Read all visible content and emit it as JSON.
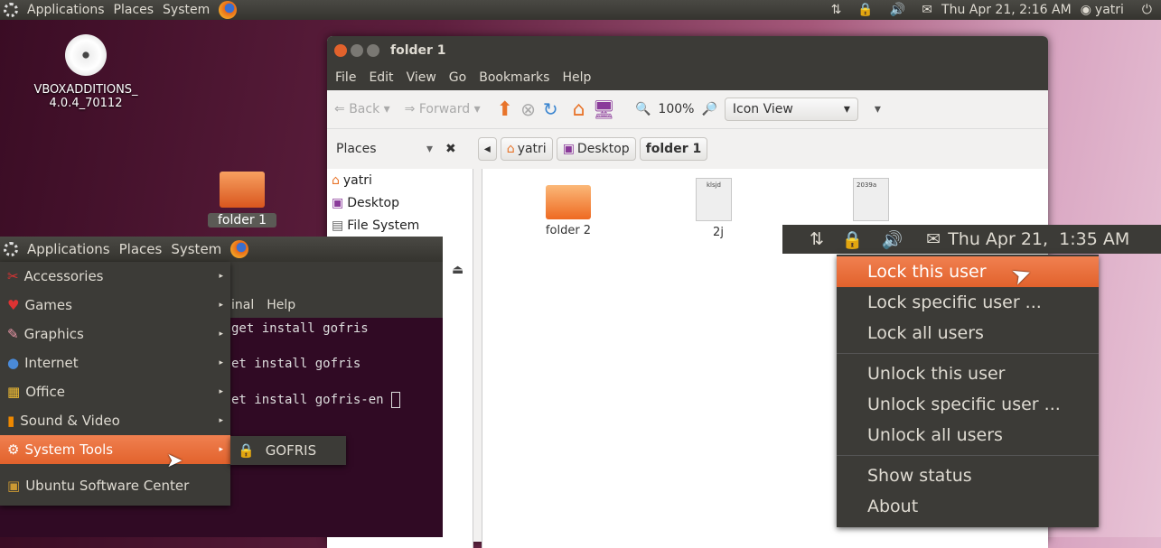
{
  "top_panel": {
    "menus": [
      "Applications",
      "Places",
      "System"
    ],
    "clock": "Thu Apr 21, 2:16 AM",
    "user": "yatri"
  },
  "desktop": {
    "icons": [
      {
        "label": "VBOXADDITIONS_\n4.0.4_70112"
      },
      {
        "label": "folder 1"
      }
    ]
  },
  "file_manager": {
    "title": "folder 1",
    "menu": [
      "File",
      "Edit",
      "View",
      "Go",
      "Bookmarks",
      "Help"
    ],
    "toolbar": {
      "back": "Back",
      "forward": "Forward",
      "zoom": "100%",
      "view_mode": "Icon View"
    },
    "sidebar_title": "Places",
    "breadcrumbs": [
      "yatri",
      "Desktop",
      "folder 1"
    ],
    "places": [
      "yatri",
      "Desktop",
      "File System"
    ],
    "items": [
      {
        "name": "folder 2",
        "type": "folder"
      },
      {
        "name": "2j",
        "type": "file",
        "preview": "klsjd"
      },
      {
        "name": "",
        "type": "file",
        "preview": "2039a"
      }
    ]
  },
  "inset_left": {
    "panel_menus": [
      "Applications",
      "Places",
      "System"
    ],
    "terminal_menu": [
      "inal",
      "Help"
    ],
    "terminal_lines": [
      "get install gofris",
      "et install gofris",
      "et install gofris-en"
    ],
    "menu_items": [
      "Accessories",
      "Games",
      "Graphics",
      "Internet",
      "Office",
      "Sound & Video",
      "System Tools",
      "Ubuntu Software Center"
    ],
    "selected": "System Tools",
    "submenu": [
      "GOFRIS"
    ]
  },
  "inset_right": {
    "clock": "Thu Apr 21,  1:35 AM",
    "menu_groups": [
      [
        "Lock this user",
        "Lock specific user ...",
        "Lock all users"
      ],
      [
        "Unlock this user",
        "Unlock specific user ...",
        "Unlock all users"
      ],
      [
        "Show status",
        "About"
      ]
    ],
    "selected": "Lock this user"
  },
  "colors": {
    "accent": "#e2622c",
    "panel": "#3c3b37",
    "terminal": "#300a24",
    "lock": "#e00000"
  }
}
